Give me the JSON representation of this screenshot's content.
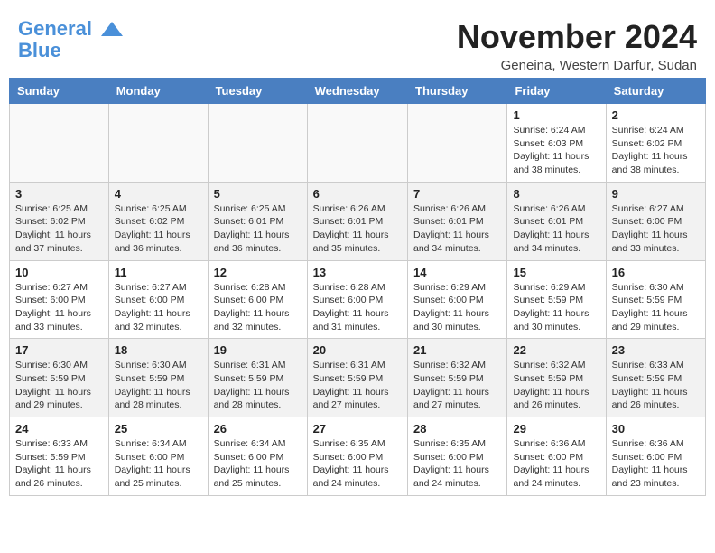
{
  "header": {
    "logo_line1": "General",
    "logo_line2": "Blue",
    "month_title": "November 2024",
    "location": "Geneina, Western Darfur, Sudan"
  },
  "weekdays": [
    "Sunday",
    "Monday",
    "Tuesday",
    "Wednesday",
    "Thursday",
    "Friday",
    "Saturday"
  ],
  "weeks": [
    [
      {
        "day": "",
        "info": ""
      },
      {
        "day": "",
        "info": ""
      },
      {
        "day": "",
        "info": ""
      },
      {
        "day": "",
        "info": ""
      },
      {
        "day": "",
        "info": ""
      },
      {
        "day": "1",
        "info": "Sunrise: 6:24 AM\nSunset: 6:03 PM\nDaylight: 11 hours and 38 minutes."
      },
      {
        "day": "2",
        "info": "Sunrise: 6:24 AM\nSunset: 6:02 PM\nDaylight: 11 hours and 38 minutes."
      }
    ],
    [
      {
        "day": "3",
        "info": "Sunrise: 6:25 AM\nSunset: 6:02 PM\nDaylight: 11 hours and 37 minutes."
      },
      {
        "day": "4",
        "info": "Sunrise: 6:25 AM\nSunset: 6:02 PM\nDaylight: 11 hours and 36 minutes."
      },
      {
        "day": "5",
        "info": "Sunrise: 6:25 AM\nSunset: 6:01 PM\nDaylight: 11 hours and 36 minutes."
      },
      {
        "day": "6",
        "info": "Sunrise: 6:26 AM\nSunset: 6:01 PM\nDaylight: 11 hours and 35 minutes."
      },
      {
        "day": "7",
        "info": "Sunrise: 6:26 AM\nSunset: 6:01 PM\nDaylight: 11 hours and 34 minutes."
      },
      {
        "day": "8",
        "info": "Sunrise: 6:26 AM\nSunset: 6:01 PM\nDaylight: 11 hours and 34 minutes."
      },
      {
        "day": "9",
        "info": "Sunrise: 6:27 AM\nSunset: 6:00 PM\nDaylight: 11 hours and 33 minutes."
      }
    ],
    [
      {
        "day": "10",
        "info": "Sunrise: 6:27 AM\nSunset: 6:00 PM\nDaylight: 11 hours and 33 minutes."
      },
      {
        "day": "11",
        "info": "Sunrise: 6:27 AM\nSunset: 6:00 PM\nDaylight: 11 hours and 32 minutes."
      },
      {
        "day": "12",
        "info": "Sunrise: 6:28 AM\nSunset: 6:00 PM\nDaylight: 11 hours and 32 minutes."
      },
      {
        "day": "13",
        "info": "Sunrise: 6:28 AM\nSunset: 6:00 PM\nDaylight: 11 hours and 31 minutes."
      },
      {
        "day": "14",
        "info": "Sunrise: 6:29 AM\nSunset: 6:00 PM\nDaylight: 11 hours and 30 minutes."
      },
      {
        "day": "15",
        "info": "Sunrise: 6:29 AM\nSunset: 5:59 PM\nDaylight: 11 hours and 30 minutes."
      },
      {
        "day": "16",
        "info": "Sunrise: 6:30 AM\nSunset: 5:59 PM\nDaylight: 11 hours and 29 minutes."
      }
    ],
    [
      {
        "day": "17",
        "info": "Sunrise: 6:30 AM\nSunset: 5:59 PM\nDaylight: 11 hours and 29 minutes."
      },
      {
        "day": "18",
        "info": "Sunrise: 6:30 AM\nSunset: 5:59 PM\nDaylight: 11 hours and 28 minutes."
      },
      {
        "day": "19",
        "info": "Sunrise: 6:31 AM\nSunset: 5:59 PM\nDaylight: 11 hours and 28 minutes."
      },
      {
        "day": "20",
        "info": "Sunrise: 6:31 AM\nSunset: 5:59 PM\nDaylight: 11 hours and 27 minutes."
      },
      {
        "day": "21",
        "info": "Sunrise: 6:32 AM\nSunset: 5:59 PM\nDaylight: 11 hours and 27 minutes."
      },
      {
        "day": "22",
        "info": "Sunrise: 6:32 AM\nSunset: 5:59 PM\nDaylight: 11 hours and 26 minutes."
      },
      {
        "day": "23",
        "info": "Sunrise: 6:33 AM\nSunset: 5:59 PM\nDaylight: 11 hours and 26 minutes."
      }
    ],
    [
      {
        "day": "24",
        "info": "Sunrise: 6:33 AM\nSunset: 5:59 PM\nDaylight: 11 hours and 26 minutes."
      },
      {
        "day": "25",
        "info": "Sunrise: 6:34 AM\nSunset: 6:00 PM\nDaylight: 11 hours and 25 minutes."
      },
      {
        "day": "26",
        "info": "Sunrise: 6:34 AM\nSunset: 6:00 PM\nDaylight: 11 hours and 25 minutes."
      },
      {
        "day": "27",
        "info": "Sunrise: 6:35 AM\nSunset: 6:00 PM\nDaylight: 11 hours and 24 minutes."
      },
      {
        "day": "28",
        "info": "Sunrise: 6:35 AM\nSunset: 6:00 PM\nDaylight: 11 hours and 24 minutes."
      },
      {
        "day": "29",
        "info": "Sunrise: 6:36 AM\nSunset: 6:00 PM\nDaylight: 11 hours and 24 minutes."
      },
      {
        "day": "30",
        "info": "Sunrise: 6:36 AM\nSunset: 6:00 PM\nDaylight: 11 hours and 23 minutes."
      }
    ]
  ]
}
